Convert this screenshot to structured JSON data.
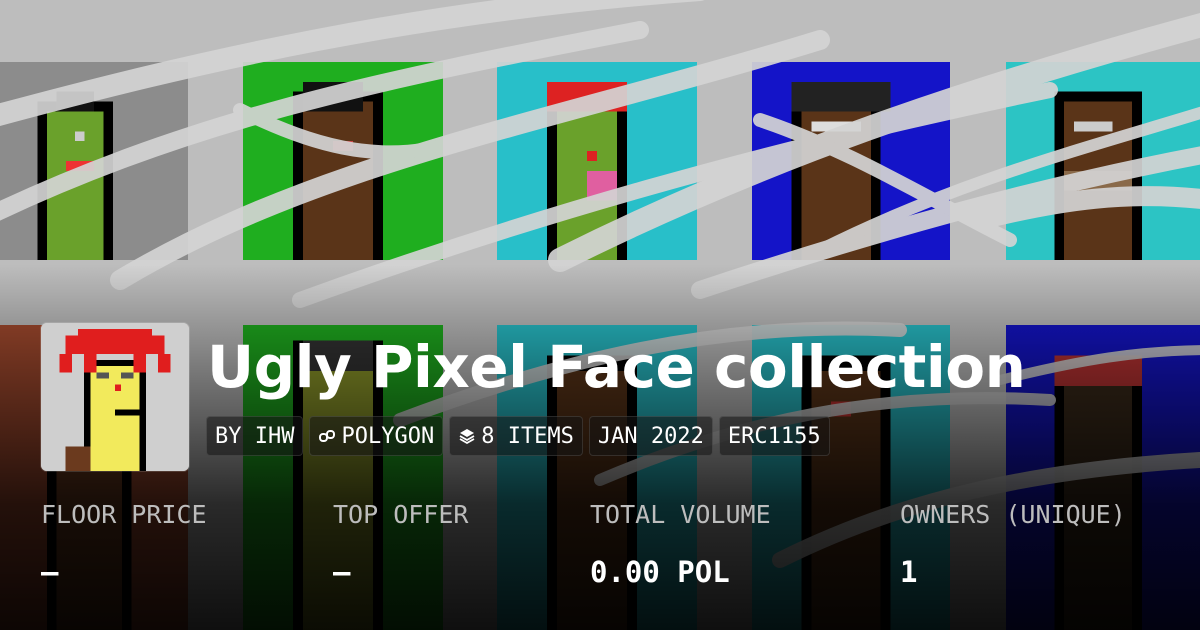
{
  "collection": {
    "title": "Ugly Pixel Face collection",
    "chips": {
      "creator": "BY IHW",
      "chain": "POLYGON",
      "items": "8 ITEMS",
      "date": "JAN 2022",
      "standard": "ERC1155"
    }
  },
  "stats": {
    "floor_price": {
      "label": "FLOOR PRICE",
      "value": "–"
    },
    "top_offer": {
      "label": "TOP OFFER",
      "value": "–"
    },
    "total_volume": {
      "label": "TOTAL VOLUME",
      "value": "0.00 POL"
    },
    "owners": {
      "label": "OWNERS (UNIQUE)",
      "value": "1"
    }
  },
  "icons": {
    "chain": "polygon-link-icon",
    "items": "layers-icon"
  },
  "colors": {
    "tile_gray": "#8c8c8c",
    "tile_green": "#1fae1f",
    "tile_cyan": "#28bfc9",
    "tile_blue": "#1414c8",
    "tile_teal": "#2cc4c4",
    "text": "#ffffff",
    "label": "#bdbdbd"
  }
}
